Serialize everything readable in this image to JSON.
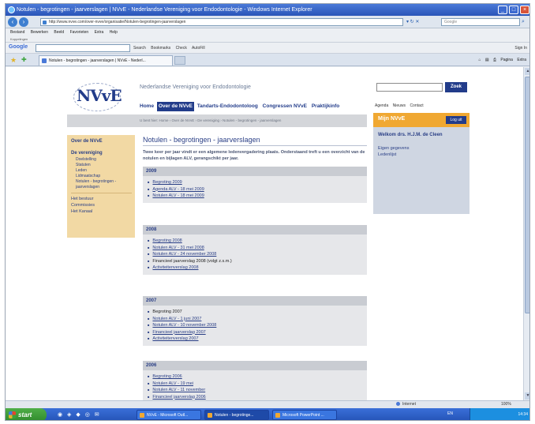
{
  "browser": {
    "title": "Notulen - begrotingen - jaarverslagen | NVvE - Nederlandse Vereniging voor Endodontologie - Windows Internet Explorer",
    "address": "http://www.nvve.com/over-nvve/organisatie/Notulen-begrotingen-jaarverslagen",
    "search_placeholder": "Google",
    "menu": [
      "Bestand",
      "Bewerken",
      "Beeld",
      "Favorieten",
      "Extra",
      "Help"
    ],
    "links_label": "Koppelingen",
    "google_label": "Google",
    "google_tools": [
      "Search",
      "Bookmarks",
      "Check",
      "AutoFill"
    ],
    "signin_label": "Sign In",
    "tab_title": "Notulen - begrotingen - jaarverslagen | NVvE - Nederl...",
    "cmd": [
      "Pagina",
      "Extra"
    ],
    "status_zone": "Internet",
    "zoom": "100%"
  },
  "site": {
    "logo": "NVvE",
    "name": "Nederlandse Vereniging voor Endodontologie",
    "nav": [
      "Home",
      "Over de NVvE",
      "Tandarts-Endodontoloog",
      "Congressen NVvE",
      "Praktijkinfo"
    ],
    "search_button": "Zoek",
    "util_links": [
      "Agenda",
      "Nieuws",
      "Contact"
    ],
    "breadcrumb": "U bent hier: Home › Over de NVvE › De vereniging › Notulen - begrotingen - jaarverslagen"
  },
  "sidebar": {
    "section1": "Over de NVvE",
    "section2": "De vereniging",
    "sub_items": [
      "Doelstelling",
      "Statuten",
      "Leden",
      "Lidmaatschap",
      "Notulen - begrotingen - jaarverslagen"
    ],
    "bottom_items": [
      "Het bestuur",
      "Commissies",
      "Het Kanaal"
    ]
  },
  "main": {
    "title": "Notulen - begrotingen - jaarverslagen",
    "intro": "Twee keer per jaar vindt er een algemene ledenvergadering plaats. Onderstaand treft u een overzicht van de notulen en bijlagen ALV, gerangschikt per jaar.",
    "years": [
      {
        "year": "2009",
        "items": [
          {
            "label": "Begroting 2009",
            "link": true
          },
          {
            "label": "Agenda ALV - 18 mei 2009",
            "link": true
          },
          {
            "label": "Notulen ALV - 18 mei 2009",
            "link": true
          }
        ]
      },
      {
        "year": "2008",
        "items": [
          {
            "label": "Begroting 2008",
            "link": true
          },
          {
            "label": "Notulen ALV - 31 mei 2008",
            "link": true
          },
          {
            "label": "Notulen ALV - 24 november 2008",
            "link": true
          },
          {
            "label": "Financieel jaarverslag 2008 (volgt z.s.m.)",
            "link": false
          },
          {
            "label": "Activiteitenverslag 2008",
            "link": true
          }
        ]
      },
      {
        "year": "2007",
        "items": [
          {
            "label": "Begroting 2007",
            "link": false
          },
          {
            "label": "Notulen ALV - 1 juni 2007",
            "link": true
          },
          {
            "label": "Notulen ALV - 10 november 2008",
            "link": true
          },
          {
            "label": "Financieel jaarverslag 2007",
            "link": true
          },
          {
            "label": "Activiteitenverslag 2007",
            "link": true
          }
        ]
      },
      {
        "year": "2006",
        "items": [
          {
            "label": "Begroting 2006",
            "link": true
          },
          {
            "label": "Notulen ALV - 19 mei",
            "link": true
          },
          {
            "label": "Notulen ALV - 11 november",
            "link": true
          },
          {
            "label": "Financieel jaarverslag 2006",
            "link": true
          }
        ]
      }
    ]
  },
  "panel": {
    "title": "Mijn NVvE",
    "logout": "Log uit",
    "welcome": "Welkom drs. H.J.M. de Cleen",
    "links": [
      "Eigen gegevens",
      "Ledenlijst"
    ]
  },
  "taskbar": {
    "start": "start",
    "tasks": [
      "NVvE - Microsoft Outl...",
      "Notulen - begrotinge...",
      "Microsoft PowerPoint ..."
    ],
    "lang": "EN",
    "clock": "14:34"
  },
  "colors": {
    "brand_blue": "#223c8a",
    "accent_orange": "#f0a832",
    "sidebar_tan": "#f2d9a4"
  }
}
